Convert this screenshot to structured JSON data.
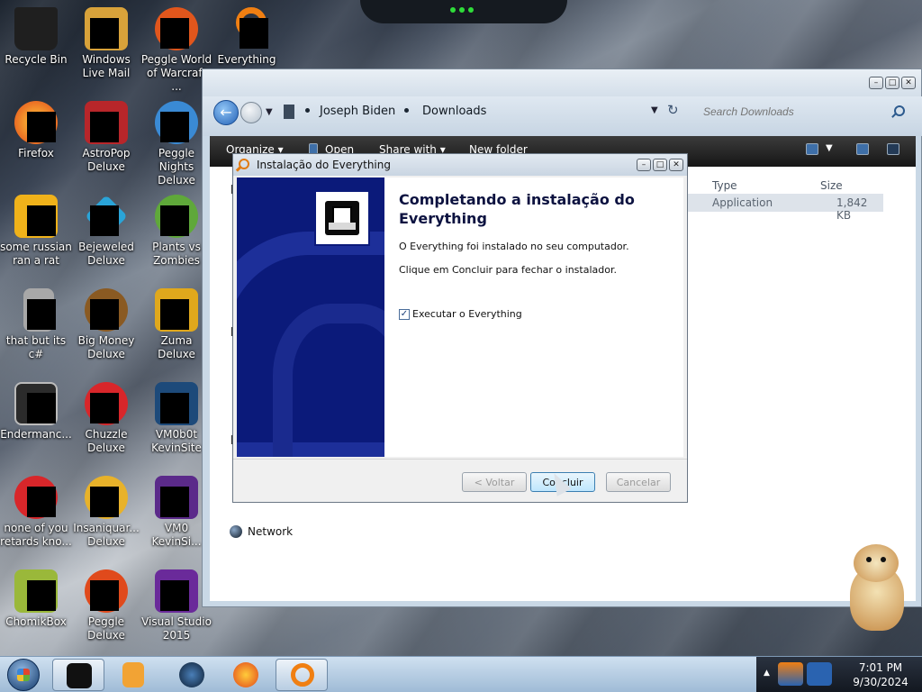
{
  "desktop": {
    "icons": [
      {
        "label": "Recycle Bin",
        "color": "#1f1f1f"
      },
      {
        "label": "Windows Live Mail",
        "color": "#d8a23a"
      },
      {
        "label": "Peggle World of Warcraft ...",
        "color": "#e1561c"
      },
      {
        "label": "Everything",
        "color": "#f07f12"
      },
      {
        "label": "Firefox",
        "color": "#ff8a1c"
      },
      {
        "label": "AstroPop Deluxe",
        "color": "#b8262a"
      },
      {
        "label": "Peggle Nights Deluxe",
        "color": "#3a8ad4"
      },
      {
        "label": "some russian ran a rat",
        "color": "#f0b21a"
      },
      {
        "label": "Bejeweled Deluxe",
        "color": "#2aa4d8"
      },
      {
        "label": "Plants vs Zombies",
        "color": "#5fa83a"
      },
      {
        "label": "that but its c#",
        "color": "#a8a8a8"
      },
      {
        "label": "Big Money Deluxe",
        "color": "#8a5a22"
      },
      {
        "label": "Zuma Deluxe",
        "color": "#e0a81c"
      },
      {
        "label": "Endermanc...",
        "color": "#2b2b2b"
      },
      {
        "label": "Chuzzle Deluxe",
        "color": "#d8262a"
      },
      {
        "label": "VM0b0t KevinSite",
        "color": "#1d4a7a"
      },
      {
        "label": "none of you retards kno...",
        "color": "#d8262a"
      },
      {
        "label": "Insaniquar... Deluxe",
        "color": "#e8b22a"
      },
      {
        "label": "VM0 KevinSi...",
        "color": "#5b2a8a"
      },
      {
        "label": "ChomikBox",
        "color": "#9ab83a"
      },
      {
        "label": "Peggle Deluxe",
        "color": "#e04a1c"
      },
      {
        "label": "Visual Studio 2015",
        "color": "#6a2a9a"
      }
    ]
  },
  "explorer": {
    "breadcrumb": [
      "Joseph Biden",
      "Downloads"
    ],
    "search_placeholder": "Search Downloads",
    "toolbar": {
      "organize": "Organize ▾",
      "open": "Open",
      "share": "Share with ▾",
      "new_folder": "New folder"
    },
    "columns": {
      "type": "Type",
      "size": "Size"
    },
    "file": {
      "type": "Application",
      "size": "1,842 KB"
    },
    "nav_network": "Network"
  },
  "setup": {
    "title": "Instalação do Everything",
    "heading": "Completando a instalação do Everything",
    "line1": "O Everything foi instalado no seu computador.",
    "line2": "Clique em Concluir para fechar o instalador.",
    "checkbox_label": "Executar o Everything",
    "checkbox_mark": "✓",
    "back_label": "< Voltar",
    "finish_label": "Concluir",
    "cancel_label": "Cancelar"
  },
  "window_controls": {
    "minimize": "–",
    "maximize": "□",
    "close": "✕"
  },
  "taskbar": {
    "time": "7:01 PM",
    "date": "9/30/2024",
    "show_hidden": "▲"
  },
  "colors": {
    "accent": "#3c7fb1",
    "installer_side": "#0b1a7a",
    "toolbar_dark": "#1e1e1e"
  }
}
